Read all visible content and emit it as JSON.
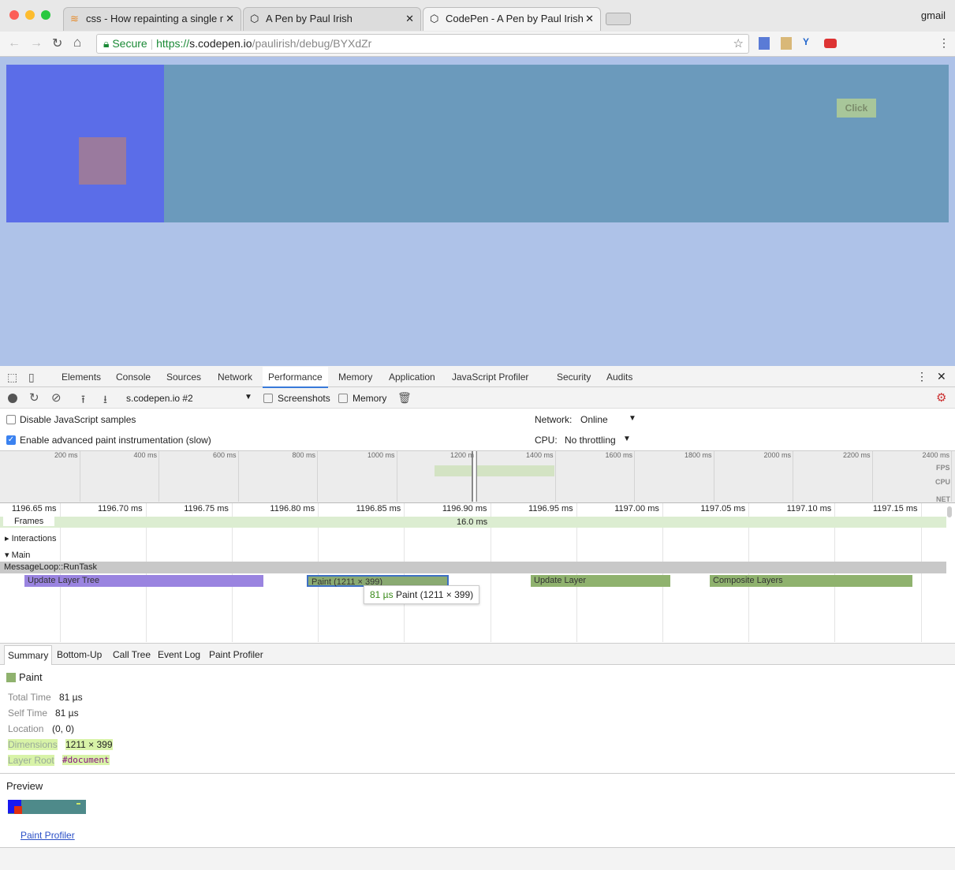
{
  "browser": {
    "tabs": [
      {
        "title": "css - How repainting a single r"
      },
      {
        "title": "A Pen by Paul Irish"
      },
      {
        "title": "CodePen - A Pen by Paul Irish"
      }
    ],
    "profile": "gmail",
    "secure_label": "Secure",
    "url_scheme": "https://",
    "url_host": "s.codepen.io",
    "url_path": "/paulirish/debug/BYXdZr"
  },
  "page": {
    "button_label": "Click"
  },
  "devtools": {
    "tabs": [
      "Elements",
      "Console",
      "Sources",
      "Network",
      "Performance",
      "Memory",
      "Application",
      "JavaScript Profiler",
      "Security",
      "Audits"
    ],
    "active_tab": "Performance",
    "recording": "s.codepen.io #2",
    "screenshots_label": "Screenshots",
    "memory_label": "Memory",
    "disable_js": "Disable JavaScript samples",
    "advanced_paint": "Enable advanced paint instrumentation (slow)",
    "network_label": "Network:",
    "network_value": "Online",
    "cpu_label": "CPU:",
    "cpu_value": "No throttling",
    "overview_ticks": [
      "200 ms",
      "400 ms",
      "600 ms",
      "800 ms",
      "1000 ms",
      "1200 m",
      "1400 ms",
      "1600 ms",
      "1800 ms",
      "2000 ms",
      "2200 ms",
      "2400 ms"
    ],
    "overview_labels": [
      "FPS",
      "CPU",
      "NET"
    ],
    "time_ticks": [
      "1196.65 ms",
      "1196.70 ms",
      "1196.75 ms",
      "1196.80 ms",
      "1196.85 ms",
      "1196.90 ms",
      "1196.95 ms",
      "1197.00 ms",
      "1197.05 ms",
      "1197.10 ms",
      "1197.15 ms"
    ],
    "frames_label": "Frames",
    "frame_duration": "16.0 ms",
    "interactions": "Interactions",
    "main": "Main",
    "runtask": "MessageLoop::RunTask",
    "events": [
      "Update Layer Tree",
      "Paint (1211 × 399)",
      "Update Layer",
      "Composite Layers"
    ],
    "tooltip": {
      "time": "81 µs",
      "label": "Paint (1211 × 399)"
    },
    "detail_tabs": [
      "Summary",
      "Bottom-Up",
      "Call Tree",
      "Event Log",
      "Paint Profiler"
    ],
    "summary": {
      "title": "Paint",
      "color": "#8fb26e",
      "rows": [
        [
          "Total Time",
          "81 µs"
        ],
        [
          "Self Time",
          "81 µs"
        ],
        [
          "Location",
          "(0, 0)"
        ],
        [
          "Dimensions",
          "1211 × 399"
        ],
        [
          "Layer Root",
          "#document"
        ]
      ]
    },
    "preview_label": "Preview",
    "paint_profiler_link": "Paint Profiler"
  }
}
